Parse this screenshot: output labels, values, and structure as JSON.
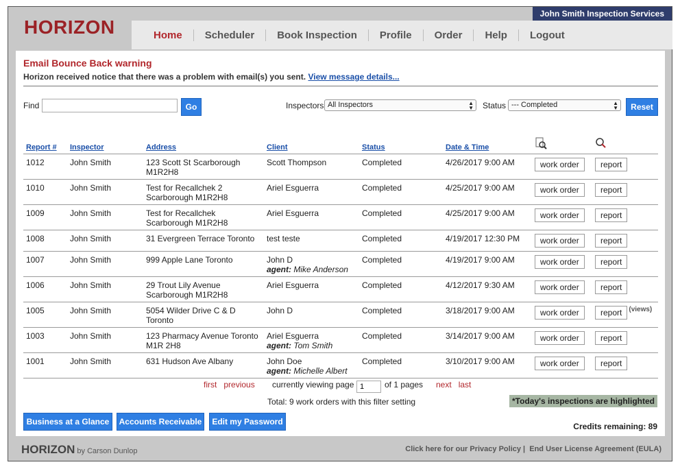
{
  "header": {
    "company": "John Smith Inspection Services",
    "logo": "HORIZON"
  },
  "nav": [
    "Home",
    "Scheduler",
    "Book Inspection",
    "Profile",
    "Order",
    "Help",
    "Logout"
  ],
  "warning": {
    "title": "Email Bounce Back warning",
    "message": "Horizon received notice that there was a problem with email(s) you sent.",
    "link": "View message details..."
  },
  "filters": {
    "find_label": "Find",
    "find_value": "",
    "go": "Go",
    "inspectors_label": "Inspectors",
    "inspectors_value": "All Inspectors",
    "status_label": "Status",
    "status_value": "--- Completed",
    "reset": "Reset"
  },
  "table": {
    "headers": [
      "Report #",
      "Inspector",
      "Address",
      "Client",
      "Status",
      "Date & Time"
    ],
    "header_icons": [
      "magnifier-document-icon",
      "magnifier-report-icon"
    ],
    "rows": [
      {
        "report": "1012",
        "inspector": "John Smith",
        "address": "123 Scott St Scarborough M1R2H8",
        "client": "Scott Thompson",
        "agent": "",
        "status": "Completed",
        "date": "4/26/2017 9:00 AM"
      },
      {
        "report": "1010",
        "inspector": "John Smith",
        "address": "Test for Recallchek 2 Scarborough M1R2H8",
        "client": "Ariel Esguerra",
        "agent": "",
        "status": "Completed",
        "date": "4/25/2017 9:00 AM"
      },
      {
        "report": "1009",
        "inspector": "John Smith",
        "address": "Test for Recallchek Scarborough M1R2H8",
        "client": "Ariel Esguerra",
        "agent": "",
        "status": "Completed",
        "date": "4/25/2017 9:00 AM"
      },
      {
        "report": "1008",
        "inspector": "John Smith",
        "address": "31 Evergreen Terrace Toronto",
        "client": "test teste",
        "agent": "",
        "status": "Completed",
        "date": "4/19/2017 12:30 PM"
      },
      {
        "report": "1007",
        "inspector": "John Smith",
        "address": "999 Apple Lane Toronto",
        "client": "John D",
        "agent": "Mike Anderson",
        "status": "Completed",
        "date": "4/19/2017 9:00 AM"
      },
      {
        "report": "1006",
        "inspector": "John Smith",
        "address": "29 Trout Lily Avenue Scarborough M1R2H8",
        "client": "Ariel Esguerra",
        "agent": "",
        "status": "Completed",
        "date": "4/12/2017 9:30 AM"
      },
      {
        "report": "1005",
        "inspector": "John Smith",
        "address": "5054 Wilder Drive C & D Toronto",
        "client": "John D",
        "agent": "",
        "status": "Completed",
        "date": "3/18/2017 9:00 AM",
        "views": "(views)"
      },
      {
        "report": "1003",
        "inspector": "John Smith",
        "address": "123 Pharmacy Avenue Toronto M1R 2H8",
        "client": "Ariel Esguerra",
        "agent": "Tom Smith",
        "status": "Completed",
        "date": "3/14/2017 9:00 AM"
      },
      {
        "report": "1001",
        "inspector": "John Smith",
        "address": "631 Hudson Ave Albany",
        "client": "John Doe",
        "agent": "Michelle Albert",
        "status": "Completed",
        "date": "3/10/2017 9:00 AM"
      }
    ],
    "work_order": "work order",
    "report_btn": "report",
    "agent_label": "agent:"
  },
  "pager": {
    "first": "first",
    "previous": "previous",
    "viewing": "currently viewing page",
    "page": "1",
    "of": "of 1 pages",
    "next": "next",
    "last": "last"
  },
  "total": "Total: 9 work orders with this filter setting",
  "highlight_note": "*Today's inspections are highlighted",
  "credits": "Credits remaining: 89",
  "bottom_buttons": [
    "Business at a Glance",
    "Accounts Receivable",
    "Edit my Password"
  ],
  "footer": {
    "logo": "HORIZON",
    "by": "by Carson Dunlop",
    "privacy": "Click here for our Privacy Policy",
    "eula": "End User License Agreement (EULA)"
  }
}
